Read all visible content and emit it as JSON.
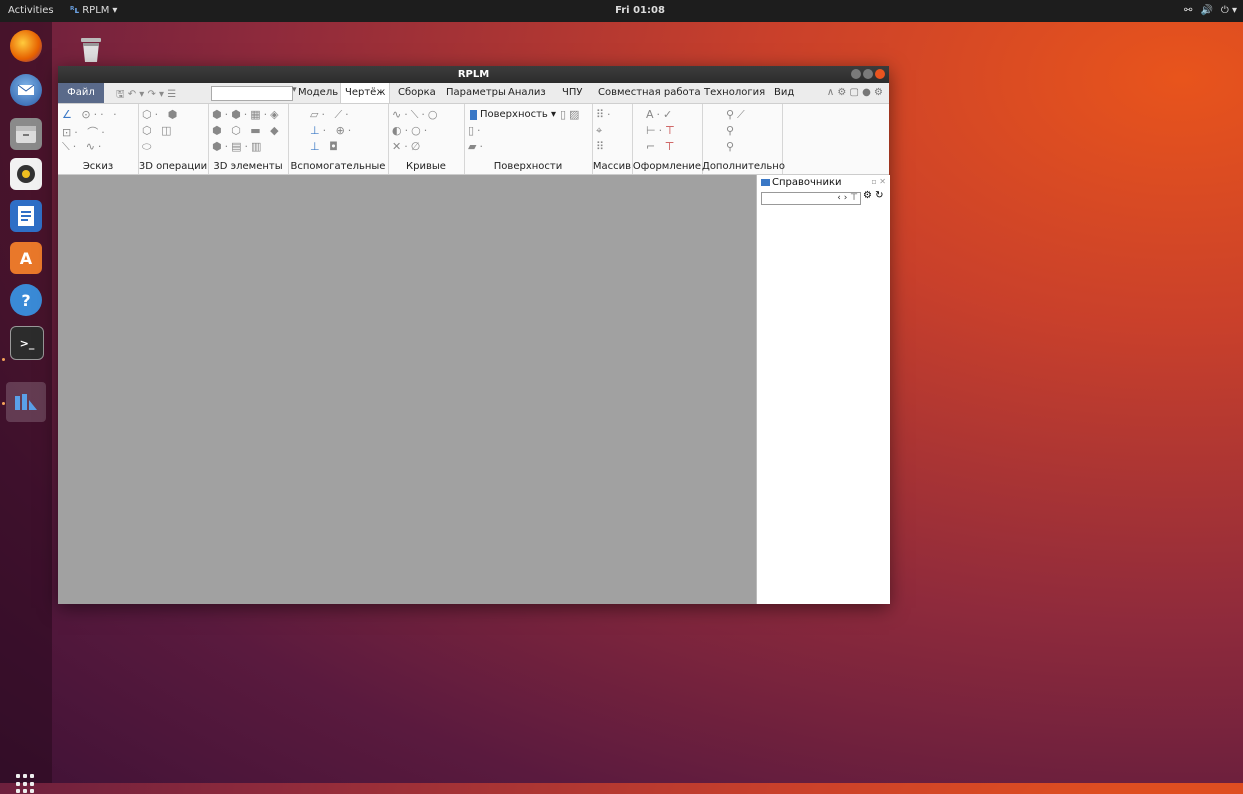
{
  "topbar": {
    "activities": "Activities",
    "app_logo": "ᴿʟ",
    "app_name": "RPLM",
    "app_arrow": "▾",
    "clock": "Fri 01:08",
    "tray_network": "⚯",
    "tray_volume": "🔊",
    "tray_power": "⏻ ▾"
  },
  "dock": {
    "items": [
      {
        "name": "Firefox",
        "icon": "firefox-icon"
      },
      {
        "name": "Thunderbird",
        "icon": "thunderbird-icon"
      },
      {
        "name": "Files",
        "icon": "files-icon"
      },
      {
        "name": "Rhythmbox",
        "icon": "rhythmbox-icon"
      },
      {
        "name": "LibreOffice Writer",
        "icon": "writer-icon"
      },
      {
        "name": "Ubuntu Software",
        "icon": "software-icon"
      },
      {
        "name": "Help",
        "icon": "help-icon"
      },
      {
        "name": "Terminal",
        "icon": "terminal-icon"
      },
      {
        "name": "RPLM",
        "icon": "rplm-icon"
      }
    ],
    "help_glyph": "?",
    "terminal_glyph": ">_",
    "software_glyph": "A"
  },
  "window": {
    "title": "RPLM",
    "file_tab": "Файл",
    "qa_icons": "🖫 ↶ ▾ ↷ ▾ ☰",
    "combo_arrow": "▾",
    "tabs": [
      "Модель",
      "Чертёж",
      "Сборка",
      "Параметры",
      "Анализ",
      "ЧПУ",
      "Совместная работа",
      "Технология",
      "Вид"
    ],
    "tab_icons": "∧ ⚙ ▢ ● ⚙"
  },
  "ribbon": {
    "groups": [
      "Эскиз",
      "3D операции",
      "3D элементы",
      "Вспомогательные",
      "Кривые",
      "Поверхности",
      "Массив",
      "Оформление",
      "Дополнительно"
    ],
    "surface_button": "Поверхность ▾"
  },
  "refpanel": {
    "title": "Справочники",
    "controls": "▫ ✕",
    "search_nav": "‹ › ⊤",
    "tools": "⚙ ↻"
  },
  "colors": {
    "accent": "#3a78c6",
    "file_tab": "#5a6a8a",
    "workspace": "#a1a1a1",
    "close_btn": "#e9541f"
  }
}
